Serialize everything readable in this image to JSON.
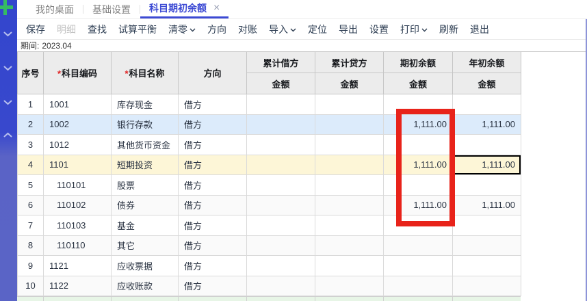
{
  "sidebar": {
    "plus_icon": "+",
    "toggles": [
      {
        "direction": "down"
      },
      {
        "direction": "down"
      },
      {
        "direction": "down"
      },
      {
        "direction": "up"
      }
    ]
  },
  "tabs": [
    {
      "label": "我的桌面",
      "active": false,
      "closable": false
    },
    {
      "label": "基础设置",
      "active": false,
      "closable": false
    },
    {
      "label": "科目期初余额",
      "active": true,
      "closable": true
    }
  ],
  "icons": {
    "close_glyph": "×",
    "plus_glyph": "+"
  },
  "toolbar": {
    "items": [
      {
        "label": "保存",
        "disabled": false,
        "dropdown": false
      },
      {
        "label": "明细",
        "disabled": true,
        "dropdown": false
      },
      {
        "label": "查找",
        "disabled": false,
        "dropdown": false
      },
      {
        "label": "试算平衡",
        "disabled": false,
        "dropdown": false
      },
      {
        "label": "清零",
        "disabled": false,
        "dropdown": true
      },
      {
        "label": "方向",
        "disabled": false,
        "dropdown": false
      },
      {
        "label": "对账",
        "disabled": false,
        "dropdown": false
      },
      {
        "label": "导入",
        "disabled": false,
        "dropdown": true
      },
      {
        "label": "定位",
        "disabled": false,
        "dropdown": false
      },
      {
        "label": "导出",
        "disabled": false,
        "dropdown": false
      },
      {
        "label": "设置",
        "disabled": false,
        "dropdown": false
      },
      {
        "label": "打印",
        "disabled": false,
        "dropdown": true
      },
      {
        "label": "刷新",
        "disabled": false,
        "dropdown": false
      },
      {
        "label": "退出",
        "disabled": false,
        "dropdown": false
      }
    ]
  },
  "period": {
    "label": "期间:",
    "value": "2023.04"
  },
  "table": {
    "required_mark": "*",
    "columns": {
      "seq": "序号",
      "code": "科目编码",
      "name": "科目名称",
      "direction": "方向"
    },
    "amount_groups": [
      "累计借方",
      "累计贷方",
      "期初余额",
      "年初余额"
    ],
    "amount_sub_label": "金额",
    "rows": [
      {
        "seq": "1",
        "code": "1001",
        "name": "库存现金",
        "direction": "借方",
        "cum_debit": "",
        "cum_credit": "",
        "begin_balance": "",
        "year_begin_balance": "",
        "style": "normal",
        "indent": false
      },
      {
        "seq": "2",
        "code": "1002",
        "name": "银行存款",
        "direction": "借方",
        "cum_debit": "",
        "cum_credit": "",
        "begin_balance": "1,111.00",
        "year_begin_balance": "1,111.00",
        "style": "selected",
        "indent": false
      },
      {
        "seq": "3",
        "code": "1012",
        "name": "其他货币资金",
        "direction": "借方",
        "cum_debit": "",
        "cum_credit": "",
        "begin_balance": "",
        "year_begin_balance": "",
        "style": "normal",
        "indent": false
      },
      {
        "seq": "4",
        "code": "1101",
        "name": "短期投资",
        "direction": "借方",
        "cum_debit": "",
        "cum_credit": "",
        "begin_balance": "1,111.00",
        "year_begin_balance": "1,111.00",
        "style": "edited",
        "indent": false,
        "active_cell": "year_begin_balance"
      },
      {
        "seq": "5",
        "code": "110101",
        "name": "股票",
        "direction": "借方",
        "cum_debit": "",
        "cum_credit": "",
        "begin_balance": "",
        "year_begin_balance": "",
        "style": "normal",
        "indent": true
      },
      {
        "seq": "6",
        "code": "110102",
        "name": "债券",
        "direction": "借方",
        "cum_debit": "",
        "cum_credit": "",
        "begin_balance": "1,111.00",
        "year_begin_balance": "1,111.00",
        "style": "stripe",
        "indent": true
      },
      {
        "seq": "7",
        "code": "110103",
        "name": "基金",
        "direction": "借方",
        "cum_debit": "",
        "cum_credit": "",
        "begin_balance": "",
        "year_begin_balance": "",
        "style": "normal",
        "indent": true
      },
      {
        "seq": "8",
        "code": "110110",
        "name": "其它",
        "direction": "借方",
        "cum_debit": "",
        "cum_credit": "",
        "begin_balance": "",
        "year_begin_balance": "",
        "style": "stripe",
        "indent": true
      },
      {
        "seq": "9",
        "code": "1121",
        "name": "应收票据",
        "direction": "借方",
        "cum_debit": "",
        "cum_credit": "",
        "begin_balance": "",
        "year_begin_balance": "",
        "style": "normal",
        "indent": false
      },
      {
        "seq": "10",
        "code": "1122",
        "name": "应收账款",
        "direction": "借方",
        "cum_debit": "",
        "cum_credit": "",
        "begin_balance": "",
        "year_begin_balance": "",
        "style": "stripe",
        "indent": false
      }
    ]
  },
  "annotation": {
    "shape": "rectangle",
    "color": "#e8231a",
    "purpose": "highlight-begin-balance-column"
  },
  "colors": {
    "accent_blue": "#3c4ad4",
    "sidebar_top": "#3346cd",
    "sidebar_bottom": "#5a64c6",
    "selected_row": "#dcebfb",
    "edited_row": "#fdf6d7",
    "stripe_row": "#fafafa",
    "total_row_green": "#e7f5e6",
    "plus_green": "#35bb63",
    "annotation_red": "#e8231a"
  }
}
